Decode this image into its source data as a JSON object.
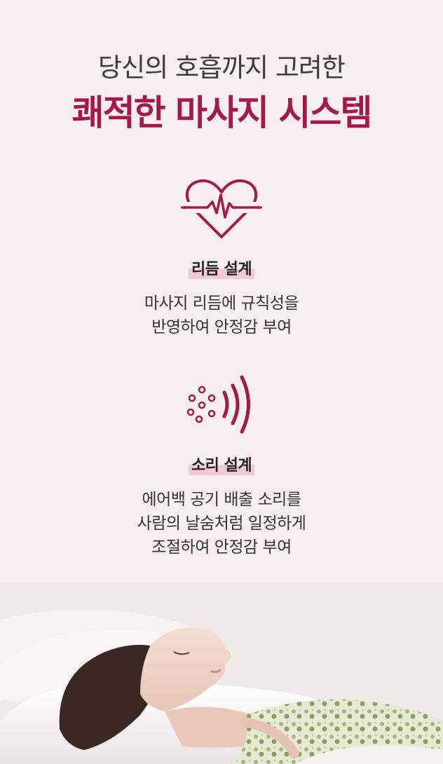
{
  "header": {
    "subtitle": "당신의 호흡까지 고려한",
    "title": "쾌적한 마사지 시스템"
  },
  "features": [
    {
      "icon": "heartbeat-icon",
      "title": "리듬 설계",
      "description": [
        "마사지 리듬에 규칙성을",
        "반영하여 안정감 부여"
      ]
    },
    {
      "icon": "sound-wave-icon",
      "title": "소리 설계",
      "description": [
        "에어백 공기 배출 소리를",
        "사람의 날숨처럼 일정하게",
        "조절하여 안정감 부여"
      ]
    }
  ],
  "colors": {
    "accent": "#a5184a",
    "background": "#f6eef1",
    "highlight": "#f2c9d6"
  }
}
